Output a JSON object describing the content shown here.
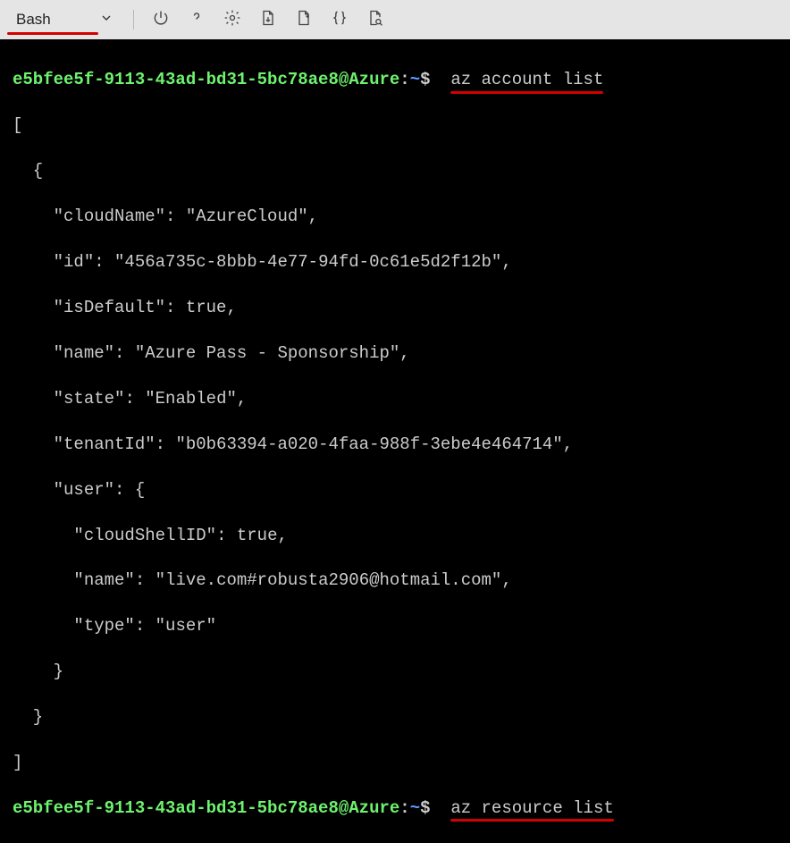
{
  "toolbar": {
    "shell_label": "Bash",
    "icons": [
      {
        "name": "chevron-down-icon"
      },
      {
        "name": "power-icon"
      },
      {
        "name": "help-icon"
      },
      {
        "name": "gear-icon"
      },
      {
        "name": "download-file-icon"
      },
      {
        "name": "upload-file-icon"
      },
      {
        "name": "braces-icon"
      },
      {
        "name": "document-search-icon"
      }
    ]
  },
  "prompt": {
    "user_host": "e5bfee5f-9113-43ad-bd31-5bc78ae8@Azure",
    "sep": ":",
    "path": "~",
    "symbol": "$"
  },
  "commands": {
    "first": "az account list",
    "second": "az resource list"
  },
  "output": {
    "open_bracket": "[",
    "open_brace": "  {",
    "lines": [
      {
        "indent": "    ",
        "key": "\"cloudName\"",
        "colon": ": ",
        "value": "\"AzureCloud\"",
        "trail": ","
      },
      {
        "indent": "    ",
        "key": "\"id\"",
        "colon": ": ",
        "value": "\"456a735c-8bbb-4e77-94fd-0c61e5d2f12b\"",
        "trail": ","
      },
      {
        "indent": "    ",
        "key": "\"isDefault\"",
        "colon": ": ",
        "value": "true",
        "trail": ","
      },
      {
        "indent": "    ",
        "key": "\"name\"",
        "colon": ": ",
        "value": "\"Azure Pass - Sponsorship\"",
        "trail": ","
      },
      {
        "indent": "    ",
        "key": "\"state\"",
        "colon": ": ",
        "value": "\"Enabled\"",
        "trail": ","
      },
      {
        "indent": "    ",
        "key": "\"tenantId\"",
        "colon": ": ",
        "value": "\"b0b63394-a020-4faa-988f-3ebe4e464714\"",
        "trail": ","
      },
      {
        "indent": "    ",
        "key": "\"user\"",
        "colon": ": ",
        "value": "{",
        "trail": ""
      },
      {
        "indent": "      ",
        "key": "\"cloudShellID\"",
        "colon": ": ",
        "value": "true",
        "trail": ","
      },
      {
        "indent": "      ",
        "key": "\"name\"",
        "colon": ": ",
        "value": "\"live.com#robusta2906@hotmail.com\"",
        "trail": ","
      },
      {
        "indent": "      ",
        "key": "\"type\"",
        "colon": ": ",
        "value": "\"user\"",
        "trail": ""
      }
    ],
    "close_user_brace": "    }",
    "close_brace": "  }",
    "close_bracket": "]"
  }
}
